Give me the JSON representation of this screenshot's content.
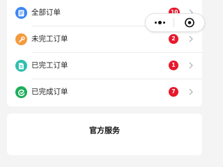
{
  "orders": {
    "items": [
      {
        "label": "全部订单",
        "badge": "10",
        "icon": "order-list-icon",
        "icon_color": "#3d87f5"
      },
      {
        "label": "未完工订单",
        "badge": "2",
        "icon": "wrench-icon",
        "icon_color": "#f59a3d"
      },
      {
        "label": "已完工订单",
        "badge": "1",
        "icon": "document-icon",
        "icon_color": "#2fbfb0"
      },
      {
        "label": "已完成订单",
        "badge": "7",
        "icon": "check-circle-icon",
        "icon_color": "#1fad5a"
      }
    ],
    "badge_color": "#e8192c"
  },
  "capsule": {
    "more_icon": "more-dots-icon",
    "close_icon": "close-target-icon"
  },
  "service": {
    "title": "官方服务"
  }
}
